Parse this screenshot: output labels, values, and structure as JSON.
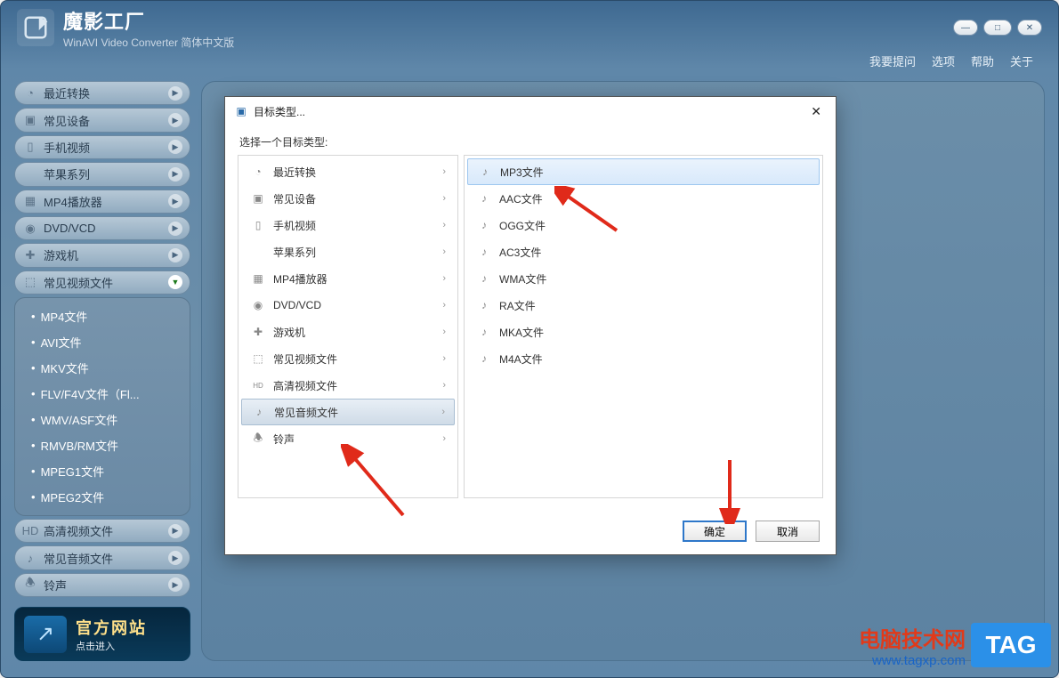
{
  "app": {
    "title": "魔影工厂",
    "subtitle": "WinAVI Video Converter 简体中文版"
  },
  "menubar": [
    "我要提问",
    "选项",
    "帮助",
    "关于"
  ],
  "sidebar": {
    "items": [
      {
        "label": "最近转换"
      },
      {
        "label": "常见设备"
      },
      {
        "label": "手机视频"
      },
      {
        "label": "苹果系列"
      },
      {
        "label": "MP4播放器"
      },
      {
        "label": "DVD/VCD"
      },
      {
        "label": "游戏机"
      },
      {
        "label": "常见视频文件",
        "expanded": true
      },
      {
        "label": "高清视频文件"
      },
      {
        "label": "常见音频文件"
      },
      {
        "label": "铃声"
      }
    ],
    "sub": [
      "MP4文件",
      "AVI文件",
      "MKV文件",
      "FLV/F4V文件（Fl...",
      "WMV/ASF文件",
      "RMVB/RM文件",
      "MPEG1文件",
      "MPEG2文件"
    ]
  },
  "banner": {
    "line1": "官方网站",
    "line2": "点击进入"
  },
  "dialog": {
    "title": "目标类型...",
    "prompt": "选择一个目标类型:",
    "left": [
      {
        "label": "最近转换",
        "icon": "clock"
      },
      {
        "label": "常见设备",
        "icon": "device"
      },
      {
        "label": "手机视频",
        "icon": "phone"
      },
      {
        "label": "苹果系列",
        "icon": "apple"
      },
      {
        "label": "MP4播放器",
        "icon": "mp4"
      },
      {
        "label": "DVD/VCD",
        "icon": "disc"
      },
      {
        "label": "游戏机",
        "icon": "game"
      },
      {
        "label": "常见视频文件",
        "icon": "film"
      },
      {
        "label": "高清视频文件",
        "icon": "hd"
      },
      {
        "label": "常见音频文件",
        "icon": "music",
        "selected": true
      },
      {
        "label": "铃声",
        "icon": "bell"
      }
    ],
    "right": [
      {
        "label": "MP3文件",
        "selected": true
      },
      {
        "label": "AAC文件"
      },
      {
        "label": "OGG文件"
      },
      {
        "label": "AC3文件"
      },
      {
        "label": "WMA文件"
      },
      {
        "label": "RA文件"
      },
      {
        "label": "MKA文件"
      },
      {
        "label": "M4A文件"
      }
    ],
    "ok": "确定",
    "cancel": "取消"
  },
  "watermark": {
    "line1": "电脑技术网",
    "line2": "www.tagxp.com",
    "tag": "TAG"
  }
}
